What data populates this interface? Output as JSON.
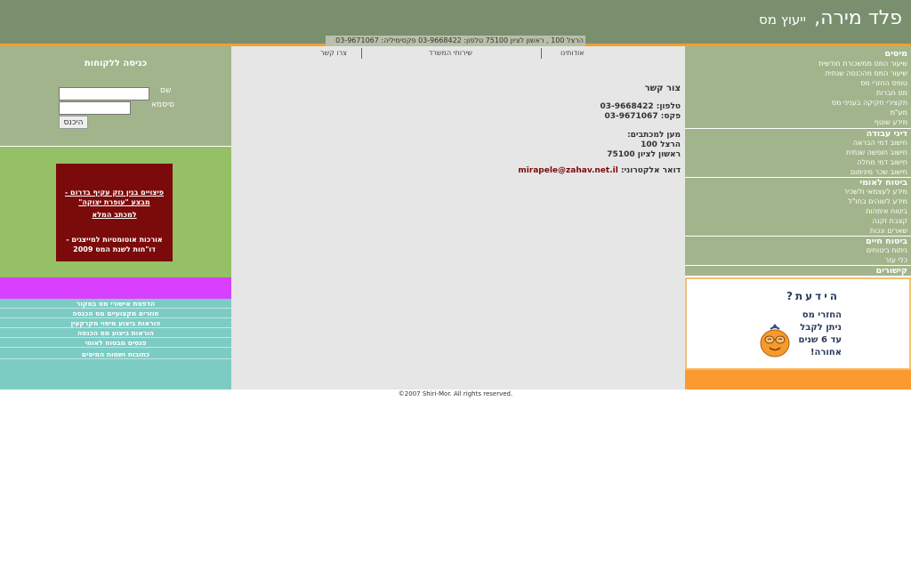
{
  "header": {
    "title_main": "פלד מירה,",
    "title_sub": "ייעוץ מס",
    "contact_strip": "הרצל 100 , ראשון לציון 75100 טלפון: 03-9668422 פקסימיליה: 03-9671067"
  },
  "login": {
    "title": "כניסה ללקוחות",
    "name_label": "שם",
    "password_label": "סיסמא",
    "submit_label": "היכנס",
    "name_value": "",
    "password_value": ""
  },
  "news": {
    "link1": "פיצויים בגין נזק עקיף בדרום - מבצע \"עופרת יצוקה\"",
    "link2": "למכתב המלא",
    "text3": "אורכות אוטומטיות למייצגים - דו\"חות לשנת המס 2009"
  },
  "teal_links": [
    "הדפסת אישורי מס במקור",
    "חוזרים מקצועיים מס הכנסה",
    "הוראות ביצוע מיסוי מקרקעין",
    "הוראות ביצוע מס הכנסה",
    "פנסים מבטוח לאומי",
    "כתובות ושמות המיסים"
  ],
  "top_nav": {
    "about": "אודותינו",
    "services": "שירותי המשרד",
    "contact": "צרו קשר"
  },
  "contact": {
    "title": "צור קשר",
    "phone": "טלפון: 03-9668422",
    "fax": "פקס: 03-9671067",
    "mail_heading": "מען למכתבים:",
    "street": "הרצל 100",
    "city": "ראשון לציון 75100",
    "email_label": "דואר אלקטרוני:",
    "email": "mirapele@zahav.net.il"
  },
  "right_nav": {
    "cat_taxes": "מיסים",
    "taxes_items": [
      "שיעור המס ממשכורת חודשית",
      "שיעור המס מהכנסה שנתית",
      "טופס החזרי מס",
      "מס חברות",
      "תקצירי חקיקה בעניני מס",
      "מע\"מ",
      "מידע שוטף"
    ],
    "cat_labor": "דיני עבודה",
    "labor_items": [
      "חישוב דמי הבראה",
      "חישוב חופשה שנתית",
      "חישוב דמי מחלה",
      "חישוב שכר מינימום"
    ],
    "cat_ni": "ביטוח לאומי",
    "ni_items": [
      "מידע לעצמאי ולשכיר",
      "מידע לשוהים בחו\"ל",
      "ביטוח אימהות",
      "קצבת זקנה",
      "שארים ונכות"
    ],
    "cat_life": "ביטוח חיים",
    "life_items": [
      "ניתוח ביטוחים",
      "כלי עזר"
    ],
    "cat_links": "קישורים"
  },
  "did_you_know": {
    "title": "הידעת?",
    "line1": "החזרי מס",
    "line2": "ניתן לקבל",
    "line3": "עד 6 שנים",
    "line4": "אחורה!"
  },
  "footer": {
    "text": "©2007 Shiri-Mor. All rights reserved."
  },
  "colors": {
    "header": "#7a8f6e",
    "accent_orange": "#f0a030",
    "sidebar_green": "#a2b48b",
    "bright_green": "#95c066",
    "magenta": "#d93fff",
    "teal": "#7cccc4",
    "news_red": "#7b0a0a",
    "center_bg": "#e6e6e6"
  }
}
